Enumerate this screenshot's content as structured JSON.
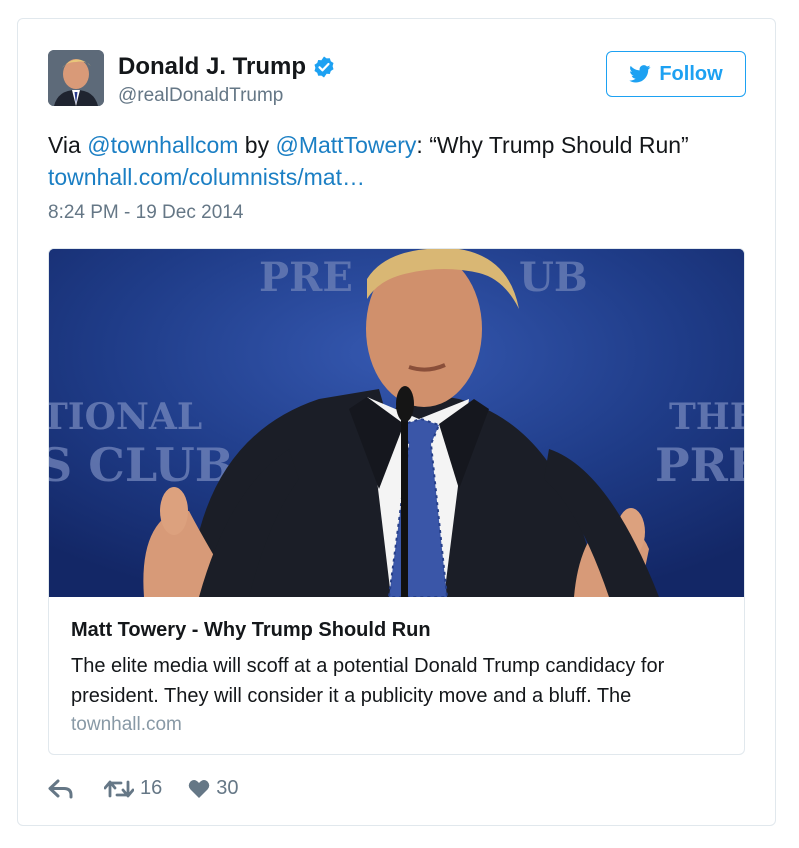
{
  "author": {
    "name": "Donald J. Trump",
    "handle": "@realDonaldTrump",
    "verified": true,
    "avatar_icon": "profile-photo"
  },
  "follow_button": {
    "label": "Follow",
    "icon": "twitter-bird-icon"
  },
  "tweet": {
    "text_prefix": "Via ",
    "mention1": "@townhallcom",
    "text_mid": " by ",
    "mention2": "@MattTowery",
    "text_suffix": ": “Why Trump Should Run”",
    "link": "townhall.com/columnists/mat…",
    "timestamp": "8:24 PM - 19 Dec 2014"
  },
  "card": {
    "image_icon": "man-speaking-at-microphone-photo",
    "title": "Matt Towery - Why Trump Should Run",
    "description": "The elite media will scoff at a potential Donald Trump candidacy for president. They will consider it a publicity move and a bluff. The",
    "domain": "townhall.com",
    "background_text_left_1": "TIONAL",
    "background_text_left_2": "S CLUB",
    "background_text_top": "PRE",
    "background_text_top_right": "UB",
    "background_text_right_1": "THE",
    "background_text_right_2": "PRE"
  },
  "actions": {
    "retweets": "16",
    "likes": "30"
  },
  "colors": {
    "link": "#1b7fc4",
    "accent": "#1da1f2",
    "muted": "#657786"
  }
}
